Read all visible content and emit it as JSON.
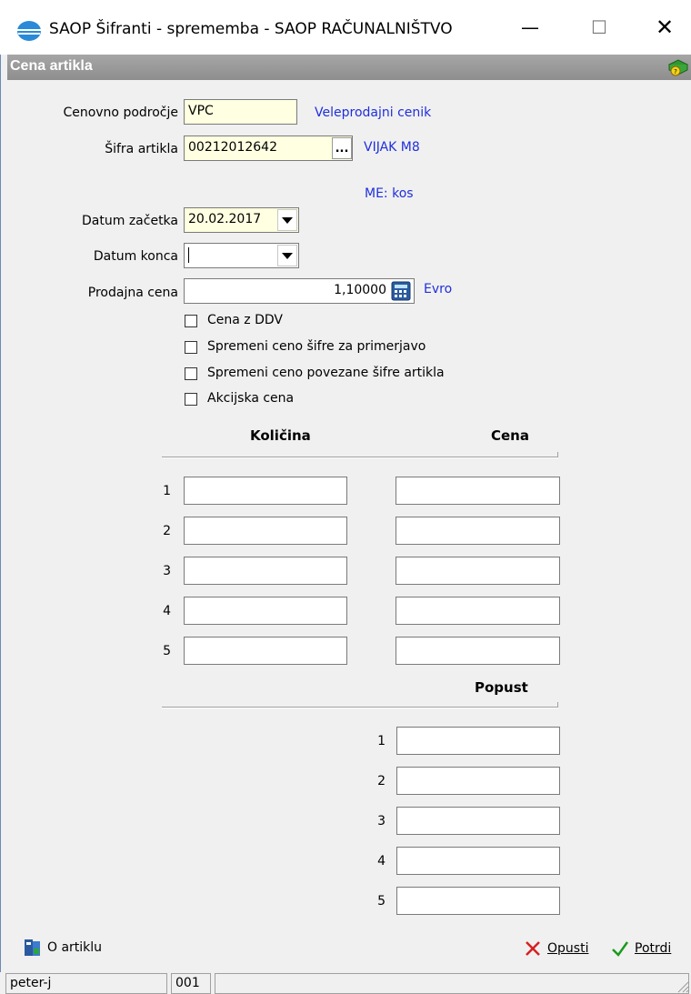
{
  "window": {
    "title": "SAOP Šifranti - sprememba - SAOP RAČUNALNIŠTVO",
    "minimize_glyph": "—",
    "maximize_glyph": "☐",
    "close_glyph": "✕"
  },
  "panel": {
    "title": "Cena artikla"
  },
  "form": {
    "price_area": {
      "label": "Cenovno področje",
      "value": "VPC",
      "description": "Veleprodajni cenik"
    },
    "item_code": {
      "label": "Šifra artikla",
      "value": "00212012642",
      "browse_label": "...",
      "description": "VIJAK M8"
    },
    "unit_text": "ME: kos",
    "start_date": {
      "label": "Datum začetka",
      "value": "20.02.2017"
    },
    "end_date": {
      "label": "Datum konca",
      "value": ""
    },
    "sale_price": {
      "label": "Prodajna cena",
      "value": "1,10000",
      "currency": "Evro"
    },
    "checkboxes": [
      {
        "label": "Cena z DDV",
        "checked": false
      },
      {
        "label": "Spremeni ceno šifre za primerjavo",
        "checked": false
      },
      {
        "label": "Spremeni ceno povezane šifre artikla",
        "checked": false
      },
      {
        "label": "Akcijska cena",
        "checked": false
      }
    ]
  },
  "quantity_price": {
    "quantity_header": "Količina",
    "price_header": "Cena",
    "rows": [
      "1",
      "2",
      "3",
      "4",
      "5"
    ]
  },
  "discount": {
    "header": "Popust",
    "rows": [
      "1",
      "2",
      "3",
      "4",
      "5"
    ]
  },
  "footer": {
    "about_label": "O artiklu",
    "cancel_label": "Opusti",
    "confirm_label": "Potrdi"
  },
  "statusbar": {
    "user": "peter-j",
    "code": "001"
  },
  "colors": {
    "accent_blue": "#1f2fdc",
    "header_gray": "#9a9a9a",
    "input_yellow": "#ffffe1"
  }
}
